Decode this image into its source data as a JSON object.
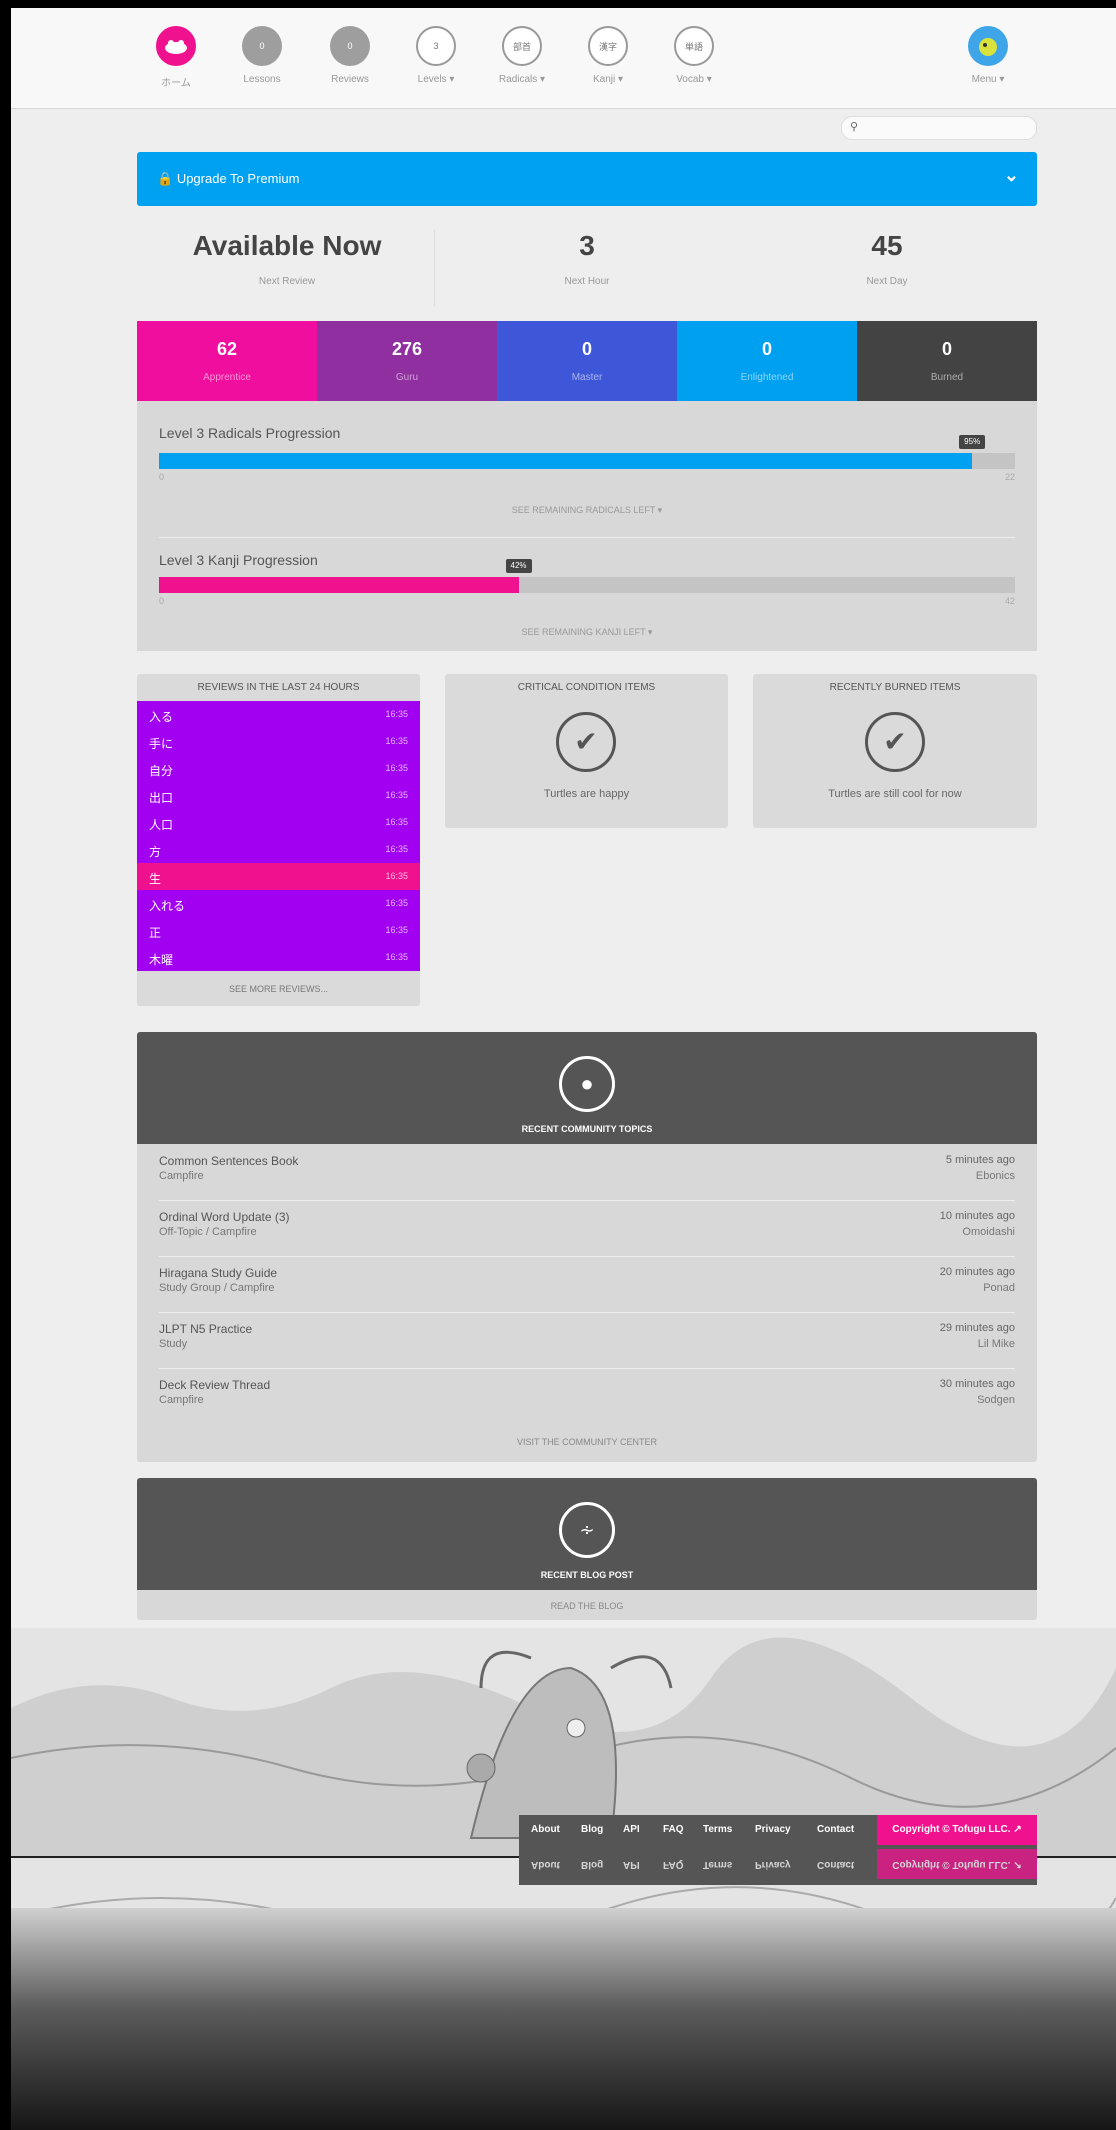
{
  "colors": {
    "brand_pink": "#f0118f",
    "upgrade_blue": "#00a1f1",
    "srs_apprentice": "#ef0e9e",
    "srs_guru": "#8f2fa0",
    "srs_master": "#3e57d9",
    "srs_enlightened": "#00a0f0",
    "srs_burned": "#434343",
    "review_row": "#a100f1",
    "review_highlight": "#f0118f"
  },
  "nav": {
    "logo_label": "ホーム",
    "items": [
      {
        "label": "Lessons",
        "badge": "0",
        "icon": "count-circle"
      },
      {
        "label": "Reviews",
        "badge": "0",
        "icon": "count-circle"
      },
      {
        "label": "Levels ▾",
        "badge": "3",
        "icon": "levels-icon"
      },
      {
        "label": "Radicals ▾",
        "badge": "部首",
        "icon": "radical-icon"
      },
      {
        "label": "Kanji ▾",
        "badge": "漢字",
        "icon": "kanji-icon"
      },
      {
        "label": "Vocab ▾",
        "badge": "単語",
        "icon": "vocab-icon"
      }
    ],
    "menu_label": "Menu ▾",
    "search_icon": "search-icon"
  },
  "upgrade": {
    "label": "Upgrade To Premium",
    "icon": "lock-icon",
    "chevron": "chevron-down-icon"
  },
  "stats": [
    {
      "value": "Available Now",
      "label": "Next Review"
    },
    {
      "value": "3",
      "label": "Next Hour"
    },
    {
      "value": "45",
      "label": "Next Day"
    }
  ],
  "srs": [
    {
      "count": "62",
      "label": "Apprentice"
    },
    {
      "count": "276",
      "label": "Guru"
    },
    {
      "count": "0",
      "label": "Master"
    },
    {
      "count": "0",
      "label": "Enlightened"
    },
    {
      "count": "0",
      "label": "Burned"
    }
  ],
  "progress": [
    {
      "title": "Level 3 Radicals Progression",
      "fill": 0.95,
      "tag": "95%",
      "min": "0",
      "max": "22",
      "link": "SEE REMAINING RADICALS LEFT ▾"
    },
    {
      "title": "Level 3 Kanji Progression",
      "fill": 0.42,
      "tag": "42%",
      "min": "0",
      "max": "42",
      "link": "SEE REMAINING KANJI LEFT ▾"
    }
  ],
  "reviews_panel": {
    "title": "REVIEWS IN THE LAST 24 HOURS",
    "rows": [
      {
        "chars": "入る",
        "time": "16:35"
      },
      {
        "chars": "手に",
        "time": "16:35"
      },
      {
        "chars": "自分",
        "time": "16:35"
      },
      {
        "chars": "出口",
        "time": "16:35"
      },
      {
        "chars": "人口",
        "time": "16:35"
      },
      {
        "chars": "方",
        "time": "16:35"
      },
      {
        "chars": "生",
        "time": "16:35"
      },
      {
        "chars": "入れる",
        "time": "16:35"
      },
      {
        "chars": "正",
        "time": "16:35"
      },
      {
        "chars": "木曜",
        "time": "16:35"
      }
    ],
    "more": "SEE MORE REVIEWS..."
  },
  "critical_panel": {
    "title": "CRITICAL CONDITION ITEMS",
    "message": "Turtles are happy",
    "icon": "check-circle-icon"
  },
  "burned_panel": {
    "title": "RECENTLY BURNED ITEMS",
    "message": "Turtles are still cool for now",
    "icon": "check-circle-icon"
  },
  "community": {
    "heading": "RECENT COMMUNITY TOPICS",
    "icon": "chat-bubbles-icon",
    "topics": [
      {
        "title": "Common Sentences Book",
        "by": "Campfire",
        "time": "5 minutes ago",
        "user": "Ebonics"
      },
      {
        "title": "Ordinal Word Update (3)",
        "by": "Off-Topic / Campfire",
        "time": "10 minutes ago",
        "user": "Omoidashi"
      },
      {
        "title": "Hiragana Study Guide",
        "by": "Study Group / Campfire",
        "time": "20 minutes ago",
        "user": "Ponad"
      },
      {
        "title": "JLPT N5 Practice",
        "by": "Study",
        "time": "29 minutes ago",
        "user": "Lil Mike"
      },
      {
        "title": "Deck Review Thread",
        "by": "Campfire",
        "time": "30 minutes ago",
        "user": "Sodgen"
      }
    ],
    "link": "VISIT THE COMMUNITY CENTER"
  },
  "blog": {
    "heading": "RECENT BLOG POST",
    "icon": "rss-icon",
    "link": "READ THE BLOG"
  },
  "footer": {
    "links": [
      "About",
      "Blog",
      "API",
      "FAQ",
      "Terms",
      "Privacy",
      "Contact"
    ],
    "copyright": "Copyright © Tofugu LLC. ↗"
  }
}
